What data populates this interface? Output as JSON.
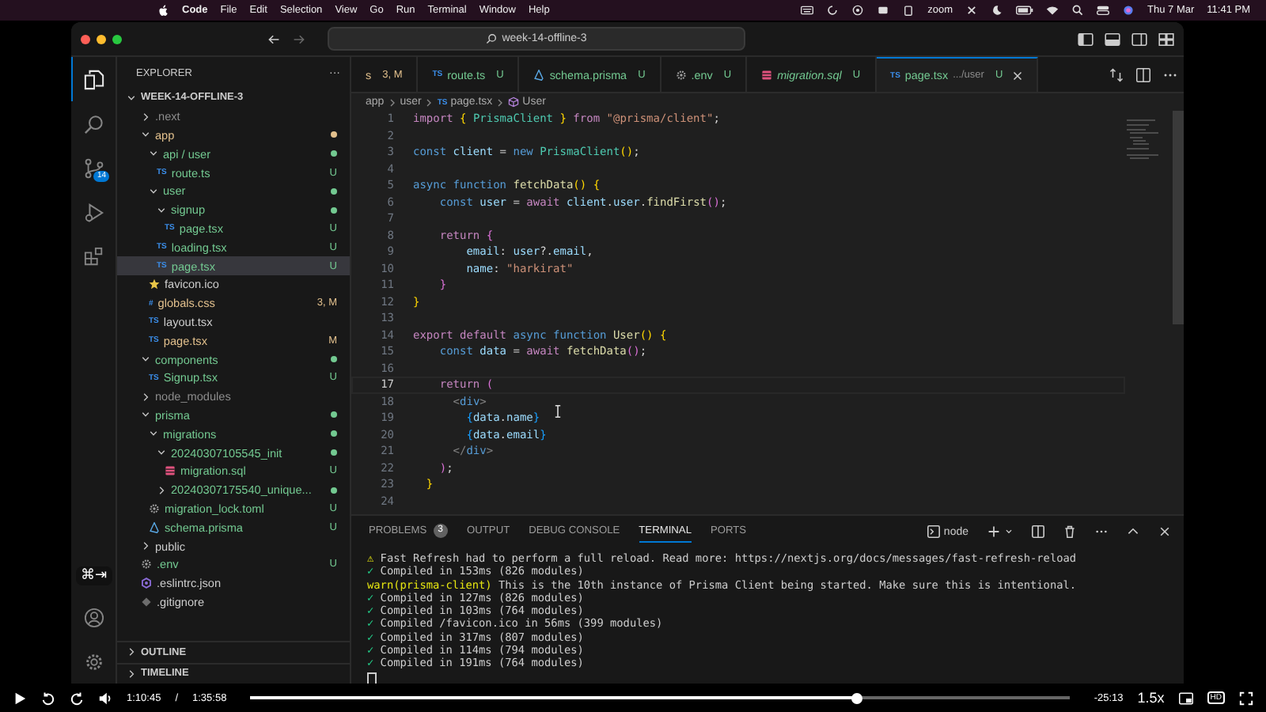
{
  "menubar": {
    "app": "Code",
    "items": [
      "File",
      "Edit",
      "Selection",
      "View",
      "Go",
      "Run",
      "Terminal",
      "Window",
      "Help"
    ],
    "zoom": "zoom",
    "date": "Thu 7 Mar",
    "time": "11:41 PM"
  },
  "window": {
    "search": "week-14-offline-3"
  },
  "activity_bar": {
    "items": [
      {
        "selected": true
      },
      {
        "selected": false
      },
      {
        "selected": false,
        "badge": "14"
      },
      {
        "selected": false
      },
      {
        "selected": false
      }
    ]
  },
  "key_overlay": "⌘⇥",
  "sidebar": {
    "title": "EXPLORER",
    "more": "···",
    "root": "WEEK-14-OFFLINE-3",
    "tree": [
      {
        "name": ".next",
        "kind": "folder",
        "expanded": false,
        "color": "#8c8c8c",
        "selected": false
      },
      {
        "name": "app",
        "kind": "folder",
        "expanded": true,
        "color": "#e2c08d",
        "dot": true,
        "selected": false,
        "children": [
          {
            "name": "api / user",
            "kind": "folder",
            "expanded": true,
            "color": "#73c991",
            "dot": true,
            "selected": false,
            "children": [
              {
                "name": "route.ts",
                "kind": "ts",
                "icon_label": "TS",
                "color": "#73c991",
                "status": "U",
                "selected": false
              }
            ]
          },
          {
            "name": "user",
            "kind": "folder",
            "expanded": true,
            "color": "#73c991",
            "dot": true,
            "selected": false,
            "children": [
              {
                "name": "signup",
                "kind": "folder",
                "expanded": true,
                "color": "#73c991",
                "dot": true,
                "selected": false,
                "children": [
                  {
                    "name": "page.tsx",
                    "kind": "ts",
                    "icon_label": "TS",
                    "color": "#73c991",
                    "status": "U",
                    "selected": false
                  }
                ]
              },
              {
                "name": "loading.tsx",
                "kind": "ts",
                "icon_label": "TS",
                "color": "#73c991",
                "status": "U",
                "selected": false
              },
              {
                "name": "page.tsx",
                "kind": "ts",
                "icon_label": "TS",
                "color": "#73c991",
                "status": "U",
                "selected": true
              }
            ]
          },
          {
            "name": "favicon.ico",
            "kind": "star",
            "color": "#cccccc",
            "selected": false
          },
          {
            "name": "globals.css",
            "kind": "css",
            "icon_label": "#",
            "color": "#e2c08d",
            "status": "3, M",
            "selected": false
          },
          {
            "name": "layout.tsx",
            "kind": "ts",
            "icon_label": "TS",
            "color": "#cccccc",
            "selected": false
          },
          {
            "name": "page.tsx",
            "kind": "ts",
            "icon_label": "TS",
            "color": "#e2c08d",
            "status": "M",
            "selected": false
          }
        ]
      },
      {
        "name": "components",
        "kind": "folder",
        "expanded": true,
        "color": "#73c991",
        "dot": true,
        "selected": false,
        "children": [
          {
            "name": "Signup.tsx",
            "kind": "ts",
            "icon_label": "TS",
            "color": "#73c991",
            "status": "U",
            "selected": false
          }
        ]
      },
      {
        "name": "node_modules",
        "kind": "folder",
        "expanded": false,
        "color": "#8c8c8c",
        "selected": false
      },
      {
        "name": "prisma",
        "kind": "folder",
        "expanded": true,
        "color": "#73c991",
        "dot": true,
        "selected": false,
        "children": [
          {
            "name": "migrations",
            "kind": "folder",
            "expanded": true,
            "color": "#73c991",
            "dot": true,
            "selected": false,
            "children": [
              {
                "name": "20240307105545_init",
                "kind": "folder",
                "expanded": true,
                "color": "#73c991",
                "dot": true,
                "selected": false,
                "children": [
                  {
                    "name": "migration.sql",
                    "kind": "sql",
                    "color": "#73c991",
                    "status": "U",
                    "selected": false
                  }
                ]
              },
              {
                "name": "20240307175540_unique...",
                "kind": "folder",
                "expanded": false,
                "color": "#73c991",
                "dot": true,
                "selected": false
              }
            ]
          },
          {
            "name": "migration_lock.toml",
            "kind": "gear",
            "color": "#73c991",
            "status": "U",
            "selected": false
          },
          {
            "name": "schema.prisma",
            "kind": "prisma",
            "color": "#73c991",
            "status": "U",
            "selected": false
          }
        ]
      },
      {
        "name": "public",
        "kind": "folder",
        "expanded": false,
        "color": "#cccccc",
        "selected": false
      },
      {
        "name": ".env",
        "kind": "gear",
        "color": "#73c991",
        "status": "U",
        "selected": false
      },
      {
        "name": ".eslintrc.json",
        "kind": "eslint",
        "color": "#cccccc",
        "selected": false
      },
      {
        "name": ".gitignore",
        "kind": "git",
        "color": "#cccccc",
        "selected": false
      }
    ],
    "sections": [
      {
        "title": "OUTLINE",
        "expanded": false
      },
      {
        "title": "TIMELINE",
        "expanded": false
      }
    ]
  },
  "tabs": [
    {
      "label": "s",
      "status": "3, M",
      "color": "#e2c08d",
      "selected": false,
      "preview": false
    },
    {
      "label": "route.ts",
      "kind": "ts",
      "icon_label": "TS",
      "status": "U",
      "color": "#73c991",
      "selected": false,
      "preview": false
    },
    {
      "label": "schema.prisma",
      "kind": "prisma",
      "status": "U",
      "color": "#73c991",
      "selected": false,
      "preview": false
    },
    {
      "label": ".env",
      "kind": "gear",
      "status": "U",
      "color": "#73c991",
      "selected": false,
      "preview": false
    },
    {
      "label": "migration.sql",
      "kind": "sql",
      "status": "U",
      "color": "#73c991",
      "selected": false,
      "preview": true
    },
    {
      "label": "page.tsx",
      "kind": "ts",
      "icon_label": "TS",
      "description": ".../user",
      "status": "U",
      "color": "#73c991",
      "selected": true,
      "preview": false
    }
  ],
  "breadcrumb": [
    {
      "label": "app"
    },
    {
      "label": "user"
    },
    {
      "label": "page.tsx",
      "kind": "ts",
      "icon_label": "TS"
    },
    {
      "label": "User",
      "kind": "component"
    }
  ],
  "code": [
    {
      "number": "1",
      "current": false,
      "tokens": [
        {
          "text": "import ",
          "kind": "kw"
        },
        {
          "text": "{",
          "kind": "b1"
        },
        {
          "text": " PrismaClient ",
          "kind": "type"
        },
        {
          "text": "}",
          "kind": "b1"
        },
        {
          "text": " from ",
          "kind": "kw"
        },
        {
          "text": "\"@prisma/client\"",
          "kind": "str"
        },
        {
          "text": ";",
          "kind": "p"
        }
      ]
    },
    {
      "number": "2",
      "current": false
    },
    {
      "number": "3",
      "current": false,
      "tokens": [
        {
          "text": "const",
          "kind": "st"
        },
        {
          "text": " client ",
          "kind": "var"
        },
        {
          "text": "= ",
          "kind": "p"
        },
        {
          "text": "new ",
          "kind": "st"
        },
        {
          "text": "PrismaClient",
          "kind": "type"
        },
        {
          "text": "()",
          "kind": "b1"
        },
        {
          "text": ";",
          "kind": "p"
        }
      ]
    },
    {
      "number": "4",
      "current": false
    },
    {
      "number": "5",
      "current": false,
      "tokens": [
        {
          "text": "async ",
          "kind": "st"
        },
        {
          "text": "function ",
          "kind": "st"
        },
        {
          "text": "fetchData",
          "kind": "fn"
        },
        {
          "text": "()",
          "kind": "b1"
        },
        {
          "text": " {",
          "kind": "b1"
        }
      ]
    },
    {
      "number": "6",
      "current": false,
      "tokens": [
        {
          "text": "    const",
          "kind": "st"
        },
        {
          "text": " user ",
          "kind": "var"
        },
        {
          "text": "= ",
          "kind": "p"
        },
        {
          "text": "await",
          "kind": "kw"
        },
        {
          "text": " client",
          "kind": "var"
        },
        {
          "text": ".",
          "kind": "p"
        },
        {
          "text": "user",
          "kind": "var"
        },
        {
          "text": ".",
          "kind": "p"
        },
        {
          "text": "findFirst",
          "kind": "fn"
        },
        {
          "text": "()",
          "kind": "b2"
        },
        {
          "text": ";",
          "kind": "p"
        }
      ]
    },
    {
      "number": "7",
      "current": false
    },
    {
      "number": "8",
      "current": false,
      "tokens": [
        {
          "text": "    return ",
          "kind": "kw"
        },
        {
          "text": "{",
          "kind": "b2"
        }
      ]
    },
    {
      "number": "9",
      "current": false,
      "tokens": [
        {
          "text": "        email",
          "kind": "var"
        },
        {
          "text": ": ",
          "kind": "p"
        },
        {
          "text": "user",
          "kind": "var"
        },
        {
          "text": "?.",
          "kind": "p"
        },
        {
          "text": "email",
          "kind": "var"
        },
        {
          "text": ",",
          "kind": "p"
        }
      ]
    },
    {
      "number": "10",
      "current": false,
      "tokens": [
        {
          "text": "        name",
          "kind": "var"
        },
        {
          "text": ": ",
          "kind": "p"
        },
        {
          "text": "\"harkirat\"",
          "kind": "str"
        }
      ]
    },
    {
      "number": "11",
      "current": false,
      "tokens": [
        {
          "text": "    }",
          "kind": "b2"
        }
      ]
    },
    {
      "number": "12",
      "current": false,
      "tokens": [
        {
          "text": "}",
          "kind": "b1"
        }
      ]
    },
    {
      "number": "13",
      "current": false
    },
    {
      "number": "14",
      "current": false,
      "tokens": [
        {
          "text": "export ",
          "kind": "kw"
        },
        {
          "text": "default ",
          "kind": "kw"
        },
        {
          "text": "async ",
          "kind": "st"
        },
        {
          "text": "function ",
          "kind": "st"
        },
        {
          "text": "User",
          "kind": "fn"
        },
        {
          "text": "()",
          "kind": "b1"
        },
        {
          "text": " {",
          "kind": "b1"
        }
      ]
    },
    {
      "number": "15",
      "current": false,
      "tokens": [
        {
          "text": "    const",
          "kind": "st"
        },
        {
          "text": " data ",
          "kind": "var"
        },
        {
          "text": "= ",
          "kind": "p"
        },
        {
          "text": "await ",
          "kind": "kw"
        },
        {
          "text": "fetchData",
          "kind": "fn"
        },
        {
          "text": "()",
          "kind": "b2"
        },
        {
          "text": ";",
          "kind": "p"
        }
      ]
    },
    {
      "number": "16",
      "current": false
    },
    {
      "number": "17",
      "current": true,
      "tokens": [
        {
          "text": "    return ",
          "kind": "kw"
        },
        {
          "text": "(",
          "kind": "b2"
        }
      ]
    },
    {
      "number": "18",
      "current": false,
      "tokens": [
        {
          "text": "      <",
          "kind": "tag"
        },
        {
          "text": "div",
          "kind": "tagname"
        },
        {
          "text": ">",
          "kind": "tag"
        }
      ]
    },
    {
      "number": "19",
      "current": false,
      "tokens": [
        {
          "text": "        {",
          "kind": "b3"
        },
        {
          "text": "data",
          "kind": "var"
        },
        {
          "text": ".",
          "kind": "p"
        },
        {
          "text": "name",
          "kind": "var"
        },
        {
          "text": "}",
          "kind": "b3"
        }
      ]
    },
    {
      "number": "20",
      "current": false,
      "tokens": [
        {
          "text": "        {",
          "kind": "b3"
        },
        {
          "text": "data",
          "kind": "var"
        },
        {
          "text": ".",
          "kind": "p"
        },
        {
          "text": "email",
          "kind": "var"
        },
        {
          "text": "}",
          "kind": "b3"
        }
      ]
    },
    {
      "number": "21",
      "current": false,
      "tokens": [
        {
          "text": "      </",
          "kind": "tag"
        },
        {
          "text": "div",
          "kind": "tagname"
        },
        {
          "text": ">",
          "kind": "tag"
        }
      ]
    },
    {
      "number": "22",
      "current": false,
      "tokens": [
        {
          "text": "    )",
          "kind": "b2"
        },
        {
          "text": ";",
          "kind": "p"
        }
      ]
    },
    {
      "number": "23",
      "current": false,
      "tokens": [
        {
          "text": "  }",
          "kind": "b1"
        }
      ]
    },
    {
      "number": "24",
      "current": false
    }
  ],
  "panel": {
    "tabs": [
      {
        "label": "PROBLEMS",
        "badge": "3",
        "selected": false
      },
      {
        "label": "OUTPUT",
        "selected": false
      },
      {
        "label": "DEBUG CONSOLE",
        "selected": false
      },
      {
        "label": "TERMINAL",
        "selected": true
      },
      {
        "label": "PORTS",
        "selected": false
      }
    ],
    "terminal_name": "node",
    "lines": [
      {
        "kind": "warn",
        "mark": "⚠",
        "text": "Fast Refresh had to perform a full reload. Read more: https://nextjs.org/docs/messages/fast-refresh-reload"
      },
      {
        "kind": "ok",
        "mark": "✓",
        "text": "Compiled in 153ms (826 modules)"
      },
      {
        "kind": "prisma",
        "prefix": "warn(prisma-client)",
        "text": "This is the 10th instance of Prisma Client being started. Make sure this is intentional."
      },
      {
        "kind": "ok",
        "mark": "✓",
        "text": "Compiled in 127ms (826 modules)"
      },
      {
        "kind": "ok",
        "mark": "✓",
        "text": "Compiled in 103ms (764 modules)"
      },
      {
        "kind": "ok",
        "mark": "✓",
        "text": "Compiled /favicon.ico in 56ms (399 modules)"
      },
      {
        "kind": "ok",
        "mark": "✓",
        "text": "Compiled in 317ms (807 modules)"
      },
      {
        "kind": "ok",
        "mark": "✓",
        "text": "Compiled in 114ms (794 modules)"
      },
      {
        "kind": "ok",
        "mark": "✓",
        "text": "Compiled in 191ms (764 modules)"
      }
    ]
  },
  "player": {
    "elapsed": "1:10:45",
    "separator": "/",
    "duration": "1:35:58",
    "level": 0.74,
    "remaining": "-25:13",
    "speed": "1.5x",
    "quality": "HD"
  }
}
